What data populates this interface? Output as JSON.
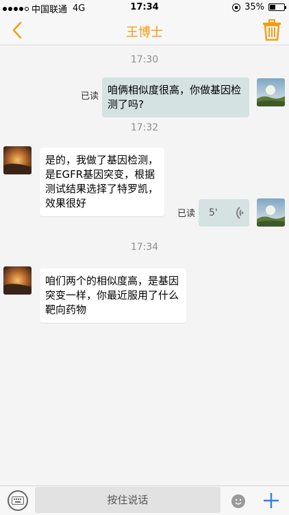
{
  "status_bar": {
    "carrier": "中国联通",
    "network": "4G",
    "time": "17:34",
    "battery": "35%",
    "battery_level": 0.35,
    "signal_bars": 4
  },
  "navbar": {
    "title": "王博士",
    "back_icon": "chevron-left-icon",
    "trash_icon": "trash-icon",
    "accent_color": "#f39c12"
  },
  "messages": [
    {
      "type": "time",
      "text": "17:30"
    },
    {
      "type": "text",
      "side": "out",
      "read_label": "已读",
      "text": "咱俩相似度很高，你做基因检测了吗?"
    },
    {
      "type": "time",
      "text": "17:32"
    },
    {
      "type": "text",
      "side": "in",
      "text": "是的，我做了基因检测，是EGFR基因突变，根据测试结果选择了特罗凯，效果很好"
    },
    {
      "type": "voice",
      "side": "out",
      "read_label": "已读",
      "duration": "5'"
    },
    {
      "type": "time",
      "text": "17:34"
    },
    {
      "type": "text",
      "side": "in",
      "text": "咱们两个的相似度高，是基因突变一样，你最近服用了什么靶向药物"
    }
  ],
  "input_bar": {
    "hold_to_talk": "按住说话",
    "keyboard_icon": "keyboard-icon",
    "emoji_icon": "emoji-icon",
    "plus_icon": "plus-icon"
  },
  "colors": {
    "outgoing_bubble": "#d5e2e2",
    "incoming_bubble": "#ffffff",
    "plus": "#2f7fe8"
  }
}
